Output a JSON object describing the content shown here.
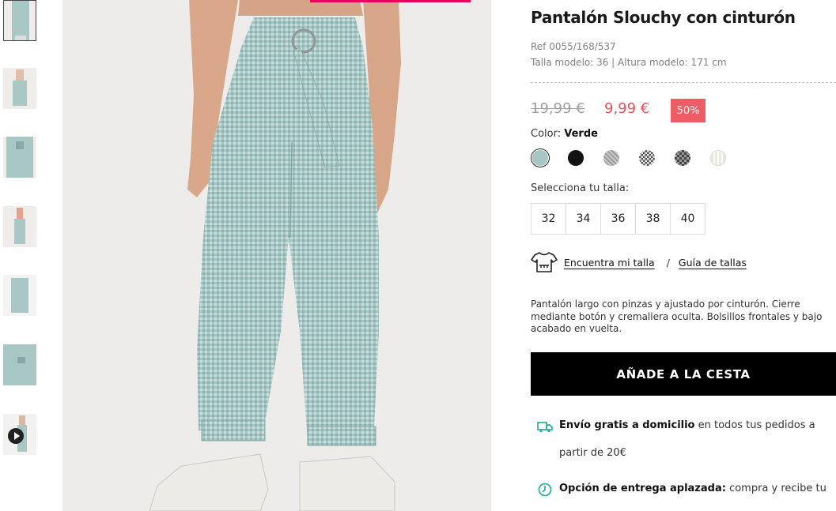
{
  "product": {
    "title": "Pantalón Slouchy con cinturón",
    "ref": "Ref 0055/168/537",
    "model_info": "Talla modelo: 36 | Altura modelo: 171 cm",
    "old_price": "19,99 €",
    "new_price": "9,99 €",
    "discount": "50%",
    "color_label": "Color:",
    "color_value": "Verde",
    "size_label": "Selecciona tu talla:",
    "sizes": [
      "32",
      "34",
      "36",
      "38",
      "40"
    ],
    "find_size": "Encuentra mi talla",
    "separator": "/",
    "size_guide": "Guía de tallas",
    "description": "Pantalón largo con pinzas y ajustado por cinturón. Cierre mediante botón y cremallera oculta. Bolsillos frontales y bajo acabado en vuelta.",
    "add_to_cart": "AÑADE A LA CESTA"
  },
  "swatch_colors": [
    "#a7c6c4",
    "#111111",
    "#9c9c9c",
    "#6b6b6b",
    "#555555",
    "#ece8e0"
  ],
  "shipping": {
    "free_bold": "Envío gratis a domicilio",
    "free_rest": "en todos tus pedidos a",
    "free_cont": "partir de 20€",
    "deferred_bold": "Opción de entrega aplazada:",
    "deferred_rest": "compra y recibe tu"
  },
  "colors": {
    "accent_pink": "#e8005a",
    "price_red": "#e8505b",
    "discount_bg": "#ee5c66",
    "shipping_icon": "#2db49a"
  },
  "icons": [
    "play-icon",
    "tshirt-icon",
    "truck-icon",
    "clock-icon"
  ]
}
